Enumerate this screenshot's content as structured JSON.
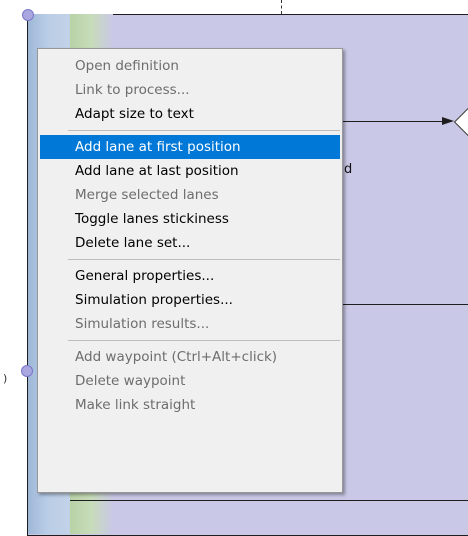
{
  "canvas": {
    "label_fragment": "d",
    "left_fragment": ")"
  },
  "context_menu": {
    "groups": [
      [
        {
          "label": "Open definition",
          "enabled": false
        },
        {
          "label": "Link to process...",
          "enabled": false
        },
        {
          "label": "Adapt size to text",
          "enabled": true
        }
      ],
      [
        {
          "label": "Add lane at first position",
          "enabled": true,
          "highlighted": true
        },
        {
          "label": "Add lane at last position",
          "enabled": true
        },
        {
          "label": "Merge selected lanes",
          "enabled": false
        },
        {
          "label": "Toggle lanes stickiness",
          "enabled": true
        },
        {
          "label": "Delete lane set...",
          "enabled": true
        }
      ],
      [
        {
          "label": "General properties...",
          "enabled": true
        },
        {
          "label": "Simulation properties...",
          "enabled": true
        },
        {
          "label": "Simulation results...",
          "enabled": false
        }
      ],
      [
        {
          "label": "Add waypoint (Ctrl+Alt+click)",
          "enabled": false
        },
        {
          "label": "Delete waypoint",
          "enabled": false
        },
        {
          "label": "Make link straight",
          "enabled": false
        }
      ]
    ]
  },
  "colors": {
    "highlight": "#0078d7",
    "pool_fill": "#c9c8e6",
    "menu_bg": "#f0f0f0",
    "disabled_text": "#6d6d6d"
  }
}
